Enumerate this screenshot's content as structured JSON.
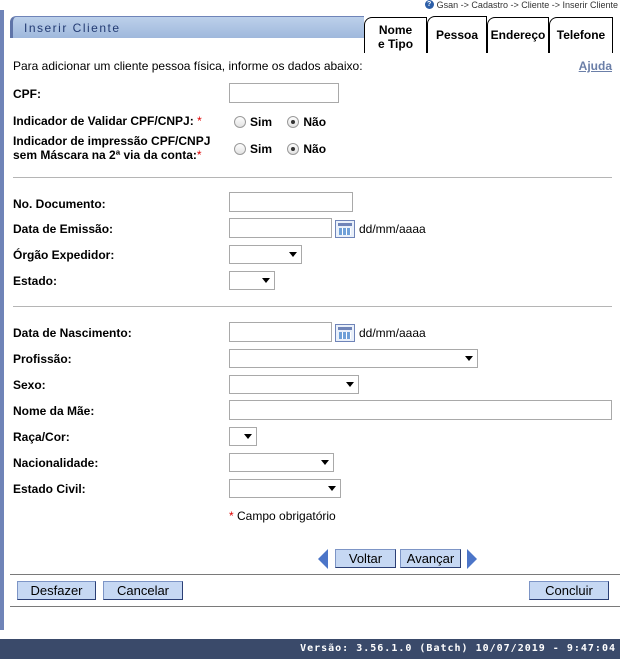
{
  "breadcrumb": "Gsan -> Cadastro -> Cliente -> Inserir Cliente",
  "title": "Inserir Cliente",
  "tabs": [
    {
      "line1": "Nome",
      "line2": "e Tipo"
    },
    {
      "line1": "Pessoa",
      "line2": ""
    },
    {
      "line1": "Endereço",
      "line2": ""
    },
    {
      "line1": "Telefone",
      "line2": ""
    }
  ],
  "active_tab": "Pessoa",
  "help_link": "Ajuda",
  "intro": "Para adicionar um cliente pessoa física, informe os dados abaixo:",
  "fields": {
    "cpf": {
      "label": "CPF:",
      "value": ""
    },
    "validar": {
      "label": "Indicador de Validar CPF/CNPJ:",
      "req": "*",
      "opt_sim": "Sim",
      "opt_nao": "Não",
      "selected": "Não"
    },
    "impressao": {
      "label1": "Indicador de impressão CPF/CNPJ",
      "label2": "sem Máscara na 2ª via da conta:",
      "req": "*",
      "opt_sim": "Sim",
      "opt_nao": "Não",
      "selected": "Não"
    },
    "documento": {
      "label": "No. Documento:",
      "value": ""
    },
    "emissao": {
      "label": "Data de Emissão:",
      "value": "",
      "hint": "dd/mm/aaaa"
    },
    "orgao": {
      "label": "Órgão Expedidor:",
      "value": ""
    },
    "estado": {
      "label": "Estado:",
      "value": ""
    },
    "nascimento": {
      "label": "Data de Nascimento:",
      "value": "",
      "hint": "dd/mm/aaaa"
    },
    "profissao": {
      "label": "Profissão:",
      "value": ""
    },
    "sexo": {
      "label": "Sexo:",
      "value": ""
    },
    "mae": {
      "label": "Nome da Mãe:",
      "value": ""
    },
    "raca": {
      "label": "Raça/Cor:",
      "value": ""
    },
    "nacionalidade": {
      "label": "Nacionalidade:",
      "value": ""
    },
    "estado_civil": {
      "label": "Estado Civil:",
      "value": ""
    }
  },
  "mandatory_note": {
    "star": "*",
    "text": " Campo obrigatório"
  },
  "buttons": {
    "voltar": "Voltar",
    "avancar": "Avançar",
    "desfazer": "Desfazer",
    "cancelar": "Cancelar",
    "concluir": "Concluir"
  },
  "footer": "Versão: 3.56.1.0 (Batch) 10/07/2019 - 9:47:04",
  "colors": {
    "accent": "#c6d8f3",
    "title_text": "#233b73",
    "footer_bg": "#3a4a6a",
    "required": "#d00"
  }
}
